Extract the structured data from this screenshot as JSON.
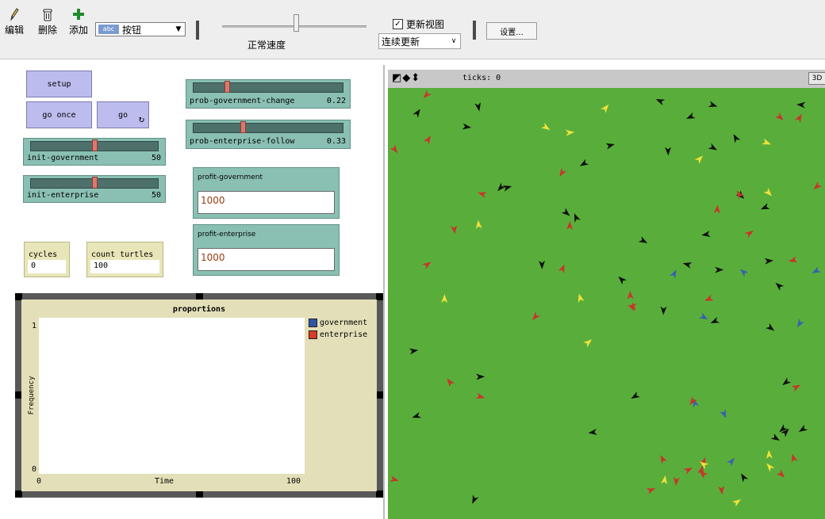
{
  "toolbar": {
    "edit_label": "编辑",
    "delete_label": "删除",
    "add_label": "添加",
    "widget_type_badge": "abc",
    "widget_type_value": "按钮",
    "speed_label": "正常速度",
    "speed_value": 0.51,
    "update_view_label": "更新视图",
    "update_view_checked": true,
    "update_mode_value": "连续更新",
    "settings_label": "设置..."
  },
  "controls": {
    "setup": "setup",
    "go_once": "go once",
    "go": "go",
    "sliders": [
      {
        "name": "prob-government-change",
        "value": "0.22",
        "fraction": 0.22
      },
      {
        "name": "prob-enterprise-follow",
        "value": "0.33",
        "fraction": 0.33
      },
      {
        "name": "init-government",
        "value": "50",
        "fraction": 0.5
      },
      {
        "name": "init-enterprise",
        "value": "50",
        "fraction": 0.5
      }
    ],
    "inputs": [
      {
        "label": "profit-government",
        "value": "1000"
      },
      {
        "label": "profit-enterprise",
        "value": "1000"
      }
    ],
    "monitors": [
      {
        "label": "cycles",
        "value": "0"
      },
      {
        "label": "count turtles",
        "value": "100"
      }
    ]
  },
  "chart_data": {
    "type": "line",
    "title": "proportions",
    "xlabel": "Time",
    "ylabel": "Frequency",
    "xlim": [
      0,
      100
    ],
    "ylim": [
      0,
      1
    ],
    "x_ticks": [
      "0",
      "100"
    ],
    "y_ticks": [
      "0",
      "1"
    ],
    "series": [
      {
        "name": "government",
        "color": "#2f55a8",
        "values": []
      },
      {
        "name": "enterprise",
        "color": "#d93a2b",
        "values": []
      }
    ],
    "legend_position": "right"
  },
  "view": {
    "ticks_label": "ticks: 0",
    "three_d": "3D",
    "arrows": "◩◆⬍",
    "background": "#59ae3b"
  }
}
